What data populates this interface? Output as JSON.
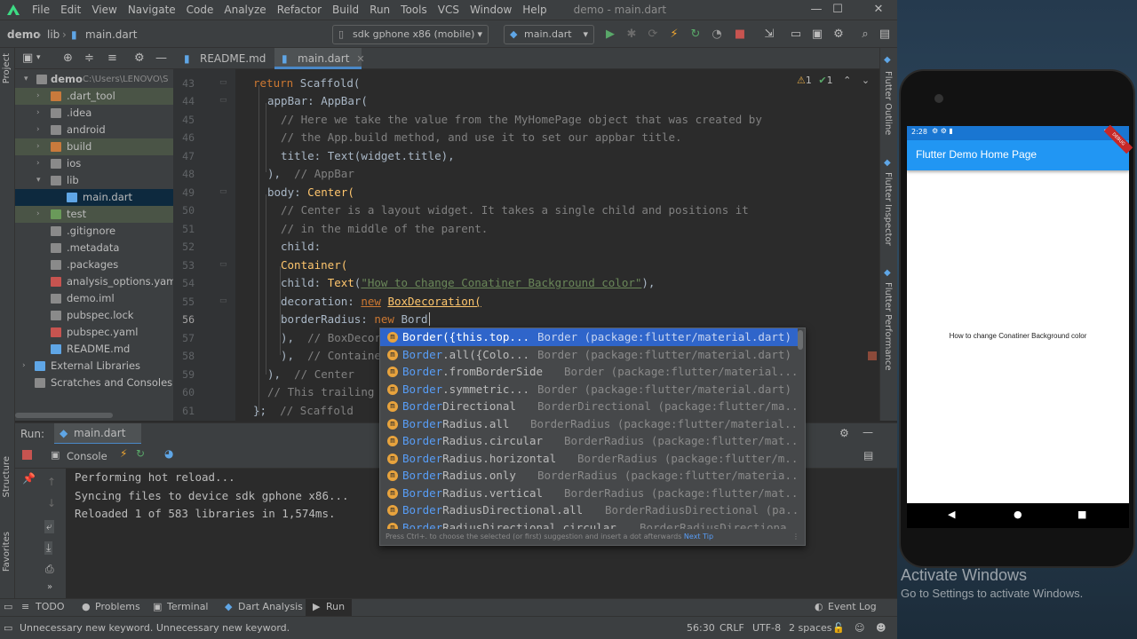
{
  "menu": {
    "items": [
      "File",
      "Edit",
      "View",
      "Navigate",
      "Code",
      "Analyze",
      "Refactor",
      "Build",
      "Run",
      "Tools",
      "VCS",
      "Window",
      "Help"
    ],
    "window_title": "demo - main.dart"
  },
  "nav": {
    "crumbs": [
      "demo",
      "lib",
      "main.dart"
    ],
    "device": "sdk gphone x86 (mobile)",
    "run_config": "main.dart"
  },
  "project": {
    "rows": [
      {
        "label": "demo",
        "path": "C:\\Users\\LENOVO\\S"
      },
      {
        "label": ".dart_tool"
      },
      {
        "label": ".idea"
      },
      {
        "label": "android"
      },
      {
        "label": "build"
      },
      {
        "label": "ios"
      },
      {
        "label": "lib"
      },
      {
        "label": "main.dart"
      },
      {
        "label": "test"
      },
      {
        "label": ".gitignore"
      },
      {
        "label": ".metadata"
      },
      {
        "label": ".packages"
      },
      {
        "label": "analysis_options.yaml"
      },
      {
        "label": "demo.iml"
      },
      {
        "label": "pubspec.lock"
      },
      {
        "label": "pubspec.yaml"
      },
      {
        "label": "README.md"
      },
      {
        "label": "External Libraries"
      },
      {
        "label": "Scratches and Consoles"
      }
    ]
  },
  "side_labels": {
    "project": "Project",
    "structure": "Structure",
    "favorites": "Favorites",
    "flutter_outline": "Flutter Outline",
    "flutter_inspector": "Flutter Inspector",
    "flutter_performance": "Flutter Performance"
  },
  "tabs": [
    {
      "label": "README.md"
    },
    {
      "label": "main.dart"
    }
  ],
  "editor": {
    "inspections": {
      "warnings": "1",
      "ok": "1"
    },
    "line_numbers": [
      "43",
      "44",
      "45",
      "46",
      "47",
      "48",
      "49",
      "50",
      "51",
      "52",
      "53",
      "54",
      "55",
      "56",
      "57",
      "58",
      "59",
      "60",
      "61"
    ],
    "lines": {
      "l43": [
        "return",
        "Scaffold("
      ],
      "l44": [
        "appBar:",
        "AppBar("
      ],
      "l45": "// Here we take the value from the MyHomePage object that was created by",
      "l46": "// the App.build method, and use it to set our appbar title.",
      "l47": [
        "title:",
        "Text",
        "(widget.title),"
      ],
      "l48": [
        "),",
        "// AppBar"
      ],
      "l49": [
        "body:",
        "Center("
      ],
      "l50": "// Center is a layout widget. It takes a single child and positions it",
      "l51": "// in the middle of the parent.",
      "l52": "child:",
      "l53": "Container(",
      "l54": [
        "child:",
        "Text",
        "(",
        "\"How to change Conatiner Background color\"",
        "),"
      ],
      "l55": [
        "decoration:",
        "new",
        "BoxDecoration("
      ],
      "l56": [
        "borderRadius:",
        "new",
        "Bord"
      ],
      "l57": [
        "),",
        "// BoxDecor"
      ],
      "l58": [
        "),",
        "// Containe"
      ],
      "l59": [
        "),",
        "// Center"
      ],
      "l60": "// This trailing",
      "l61": [
        "};",
        "// Scaffold"
      ]
    }
  },
  "autocomplete": {
    "items": [
      {
        "match": "Border",
        "rest": "({this.top...",
        "type": "Border (package:flutter/material.dart)"
      },
      {
        "match": "Border",
        "rest": ".all({Colo...",
        "type": "Border (package:flutter/material.dart)"
      },
      {
        "match": "Border",
        "rest": ".fromBorderSide",
        "type": "Border (package:flutter/material..."
      },
      {
        "match": "Border",
        "rest": ".symmetric...",
        "type": "Border (package:flutter/material.dart)"
      },
      {
        "match": "Border",
        "rest": "Directional",
        "type": "BorderDirectional (package:flutter/ma..."
      },
      {
        "match": "Border",
        "rest": "Radius.all",
        "type": "BorderRadius (package:flutter/material..."
      },
      {
        "match": "Border",
        "rest": "Radius.circular",
        "type": "BorderRadius (package:flutter/mat..."
      },
      {
        "match": "Border",
        "rest": "Radius.horizontal",
        "type": "BorderRadius (package:flutter/m..."
      },
      {
        "match": "Border",
        "rest": "Radius.only",
        "type": "BorderRadius (package:flutter/materia..."
      },
      {
        "match": "Border",
        "rest": "Radius.vertical",
        "type": "BorderRadius (package:flutter/mat..."
      },
      {
        "match": "Border",
        "rest": "RadiusDirectional.all",
        "type": "BorderRadiusDirectional (pa..."
      },
      {
        "match": "Border",
        "rest": "RadiusDirectional.circular",
        "type": "BorderRadiusDirectiona..."
      }
    ],
    "footer": "Press Ctrl+. to choose the selected (or first) suggestion and insert a dot afterwards",
    "next_tip": "Next Tip"
  },
  "run": {
    "label": "Run:",
    "tab": "main.dart",
    "console_label": "Console",
    "output": [
      "Performing hot reload...",
      "Syncing files to device sdk gphone x86...",
      "Reloaded 1 of 583 libraries in 1,574ms."
    ]
  },
  "bottom_tabs": [
    "TODO",
    "Problems",
    "Terminal",
    "Dart Analysis",
    "Run"
  ],
  "event_log": "Event Log",
  "status": {
    "message": "Unnecessary new keyword. Unnecessary new keyword.",
    "position": "56:30",
    "line_sep": "CRLF",
    "encoding": "UTF-8",
    "indent": "2 spaces"
  },
  "emulator": {
    "time": "2:28",
    "app_title": "Flutter Demo Home Page",
    "body_text": "How to change Conatiner Background color",
    "debug_banner": "DEBUG"
  },
  "watermark": {
    "title": "Activate Windows",
    "subtitle": "Go to Settings to activate Windows."
  },
  "colors": {
    "accent": "#4a88c7",
    "app_bar": "#2196f3",
    "status_bar": "#1976d2",
    "selection": "#2f65ca"
  }
}
